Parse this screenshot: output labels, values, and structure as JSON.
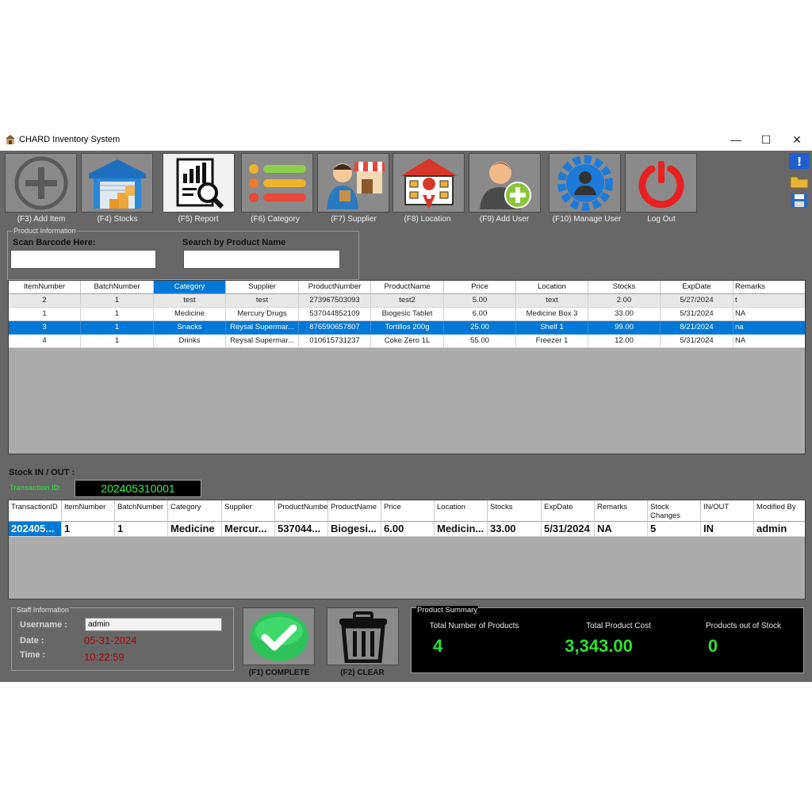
{
  "window": {
    "title": "CHARD Inventory System",
    "minimize": "—",
    "maximize": "☐",
    "close": "✕"
  },
  "toolbar": [
    {
      "label": "(F3) Add Item",
      "icon": "plus-circle-icon"
    },
    {
      "label": "(F4) Stocks",
      "icon": "warehouse-icon"
    },
    {
      "label": "(F5) Report",
      "icon": "report-icon"
    },
    {
      "label": "(F6) Category",
      "icon": "list-icon"
    },
    {
      "label": "(F7) Supplier",
      "icon": "supplier-icon"
    },
    {
      "label": "(F8) Location",
      "icon": "location-icon"
    },
    {
      "label": "(F9) Add User",
      "icon": "add-user-icon"
    },
    {
      "label": "(F10) Manage User",
      "icon": "manage-user-icon"
    },
    {
      "label": "Log Out",
      "icon": "power-icon"
    }
  ],
  "side_icons": [
    "info-icon",
    "folder-icon",
    "save-icon"
  ],
  "product_info": {
    "legend": "Product Information",
    "scan_label": "Scan Barcode Here:",
    "scan_value": "",
    "search_label": "Search by Product Name",
    "search_value": ""
  },
  "product_table": {
    "columns": [
      "ItemNumber",
      "BatchNumber",
      "Category",
      "Supplier",
      "ProductNumber",
      "ProductName",
      "Price",
      "Location",
      "Stocks",
      "ExpDate",
      "Remarks"
    ],
    "rows": [
      [
        "2",
        "1",
        "test",
        "test",
        "273967503093",
        "test2",
        "5.00",
        "text",
        "2.00",
        "5/27/2024",
        "t"
      ],
      [
        "1",
        "1",
        "Medicine",
        "Mercury Drugs",
        "537044852109",
        "Biogesic Tablet",
        "6.00",
        "Medicine Box 3",
        "33.00",
        "5/31/2024",
        "NA"
      ],
      [
        "3",
        "1",
        "Snacks",
        "Reysal Supermar...",
        "876590657807",
        "Tortillos 200g",
        "25.00",
        "Shelf 1",
        "99.00",
        "8/21/2024",
        "na"
      ],
      [
        "4",
        "1",
        "Drinks",
        "Reysal Supermar...",
        "010615731237",
        "Coke Zero 1L",
        "55.00",
        "Freezer 1",
        "12.00",
        "5/31/2024",
        "NA"
      ]
    ],
    "selected_row": 2,
    "selected_column": 2
  },
  "stock_inout": {
    "label": "Stock IN / OUT :",
    "transaction_label": "Transaction ID:",
    "transaction_id": "202405310001"
  },
  "transaction_table": {
    "columns": [
      "TransactionID",
      "ItemNumber",
      "BatchNumber",
      "Category",
      "Supplier",
      "ProductNumbe",
      "ProductName",
      "Price",
      "Location",
      "Stocks",
      "ExpDate",
      "Remarks",
      "Stock Changes",
      "IN/OUT",
      "Modified By"
    ],
    "rows": [
      [
        "202405...",
        "1",
        "1",
        "Medicine",
        "Mercur...",
        "537044...",
        "Biogesi...",
        "6.00",
        "Medicin...",
        "33.00",
        "5/31/2024",
        "NA",
        "5",
        "IN",
        "admin"
      ]
    ]
  },
  "staff": {
    "legend": "Staff Information",
    "username_label": "Username :",
    "username": "admin",
    "date_label": "Date :",
    "date": "05-31-2024",
    "time_label": "Time :",
    "time": "10:22:59"
  },
  "actions": {
    "complete_label": "(F1) COMPLETE",
    "clear_label": "(F2) CLEAR"
  },
  "summary": {
    "legend": "Product Summary",
    "total_products_label": "Total Number of Products",
    "total_products": "4",
    "total_cost_label": "Total Product Cost",
    "total_cost": "3,343.00",
    "out_of_stock_label": "Products out of Stock",
    "out_of_stock": "0"
  },
  "colors": {
    "app_bg": "#676767",
    "selection": "#0078d7",
    "value_green": "#2ee02e",
    "time_red": "#b00000"
  }
}
